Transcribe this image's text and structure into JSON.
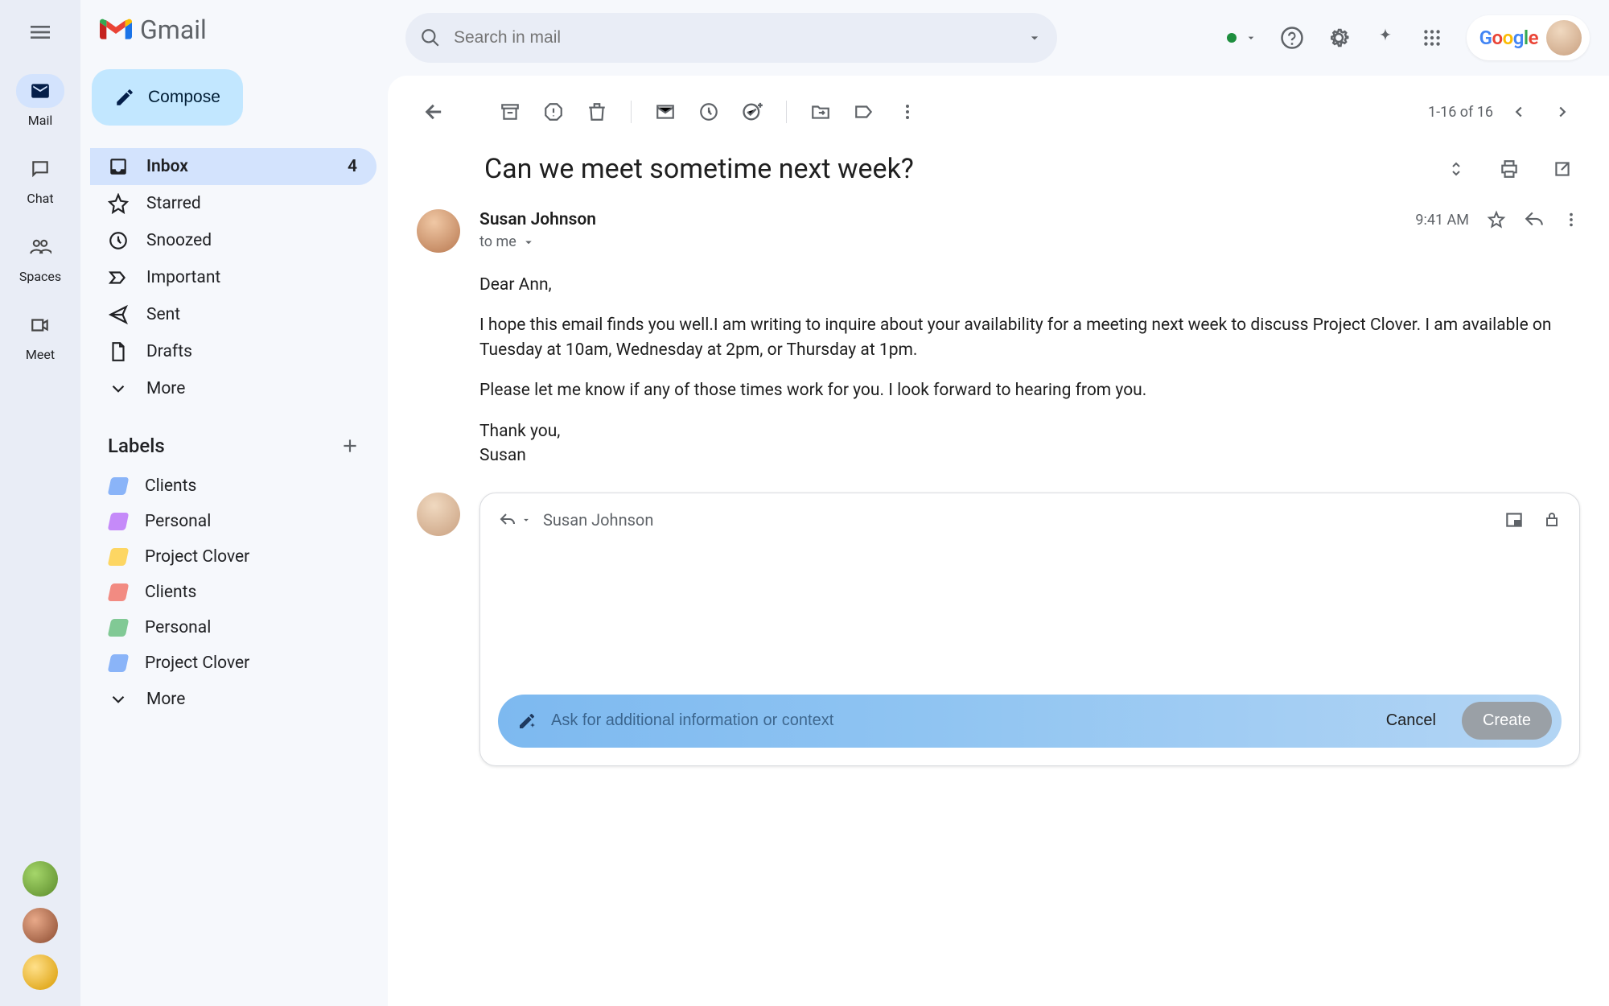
{
  "app": {
    "name": "Gmail"
  },
  "rail": {
    "items": [
      {
        "label": "Mail"
      },
      {
        "label": "Chat"
      },
      {
        "label": "Spaces"
      },
      {
        "label": "Meet"
      }
    ]
  },
  "sidebar": {
    "compose_label": "Compose",
    "nav": [
      {
        "label": "Inbox",
        "count": "4"
      },
      {
        "label": "Starred"
      },
      {
        "label": "Snoozed"
      },
      {
        "label": "Important"
      },
      {
        "label": "Sent"
      },
      {
        "label": "Drafts"
      },
      {
        "label": "More"
      }
    ],
    "labels_header": "Labels",
    "labels": [
      {
        "label": "Clients",
        "color": "#8ab4f8"
      },
      {
        "label": "Personal",
        "color": "#c58af9"
      },
      {
        "label": "Project Clover",
        "color": "#fdd663"
      },
      {
        "label": "Clients",
        "color": "#f28b82"
      },
      {
        "label": "Personal",
        "color": "#81c995"
      },
      {
        "label": "Project Clover",
        "color": "#8ab4f8"
      },
      {
        "label": "More"
      }
    ]
  },
  "header": {
    "search_placeholder": "Search in mail"
  },
  "toolbar": {
    "page_info": "1-16 of 16"
  },
  "message": {
    "subject": "Can we meet sometime next week?",
    "sender": "Susan Johnson",
    "to_line": "to me",
    "time": "9:41 AM",
    "body": {
      "greeting": "Dear Ann,",
      "p1": "I hope this email finds you well.I am writing to inquire about your availability for a meeting next week to discuss Project Clover. I am available on Tuesday at 10am, Wednesday at 2pm, or Thursday at 1pm.",
      "p2": "Please let me know if any of those times work for you. I look forward to hearing from you.",
      "signoff1": "Thank you,",
      "signoff2": "Susan"
    }
  },
  "reply": {
    "recipient": "Susan Johnson",
    "ai_placeholder": "Ask for additional information or context",
    "cancel_label": "Cancel",
    "create_label": "Create"
  },
  "colors": {
    "avatar_user": "#e8c9a8",
    "avatar_sender": "#d9a07a",
    "rail_av1": "#7cb342",
    "rail_av2": "#b0674a",
    "rail_av3": "#fbbc04"
  }
}
